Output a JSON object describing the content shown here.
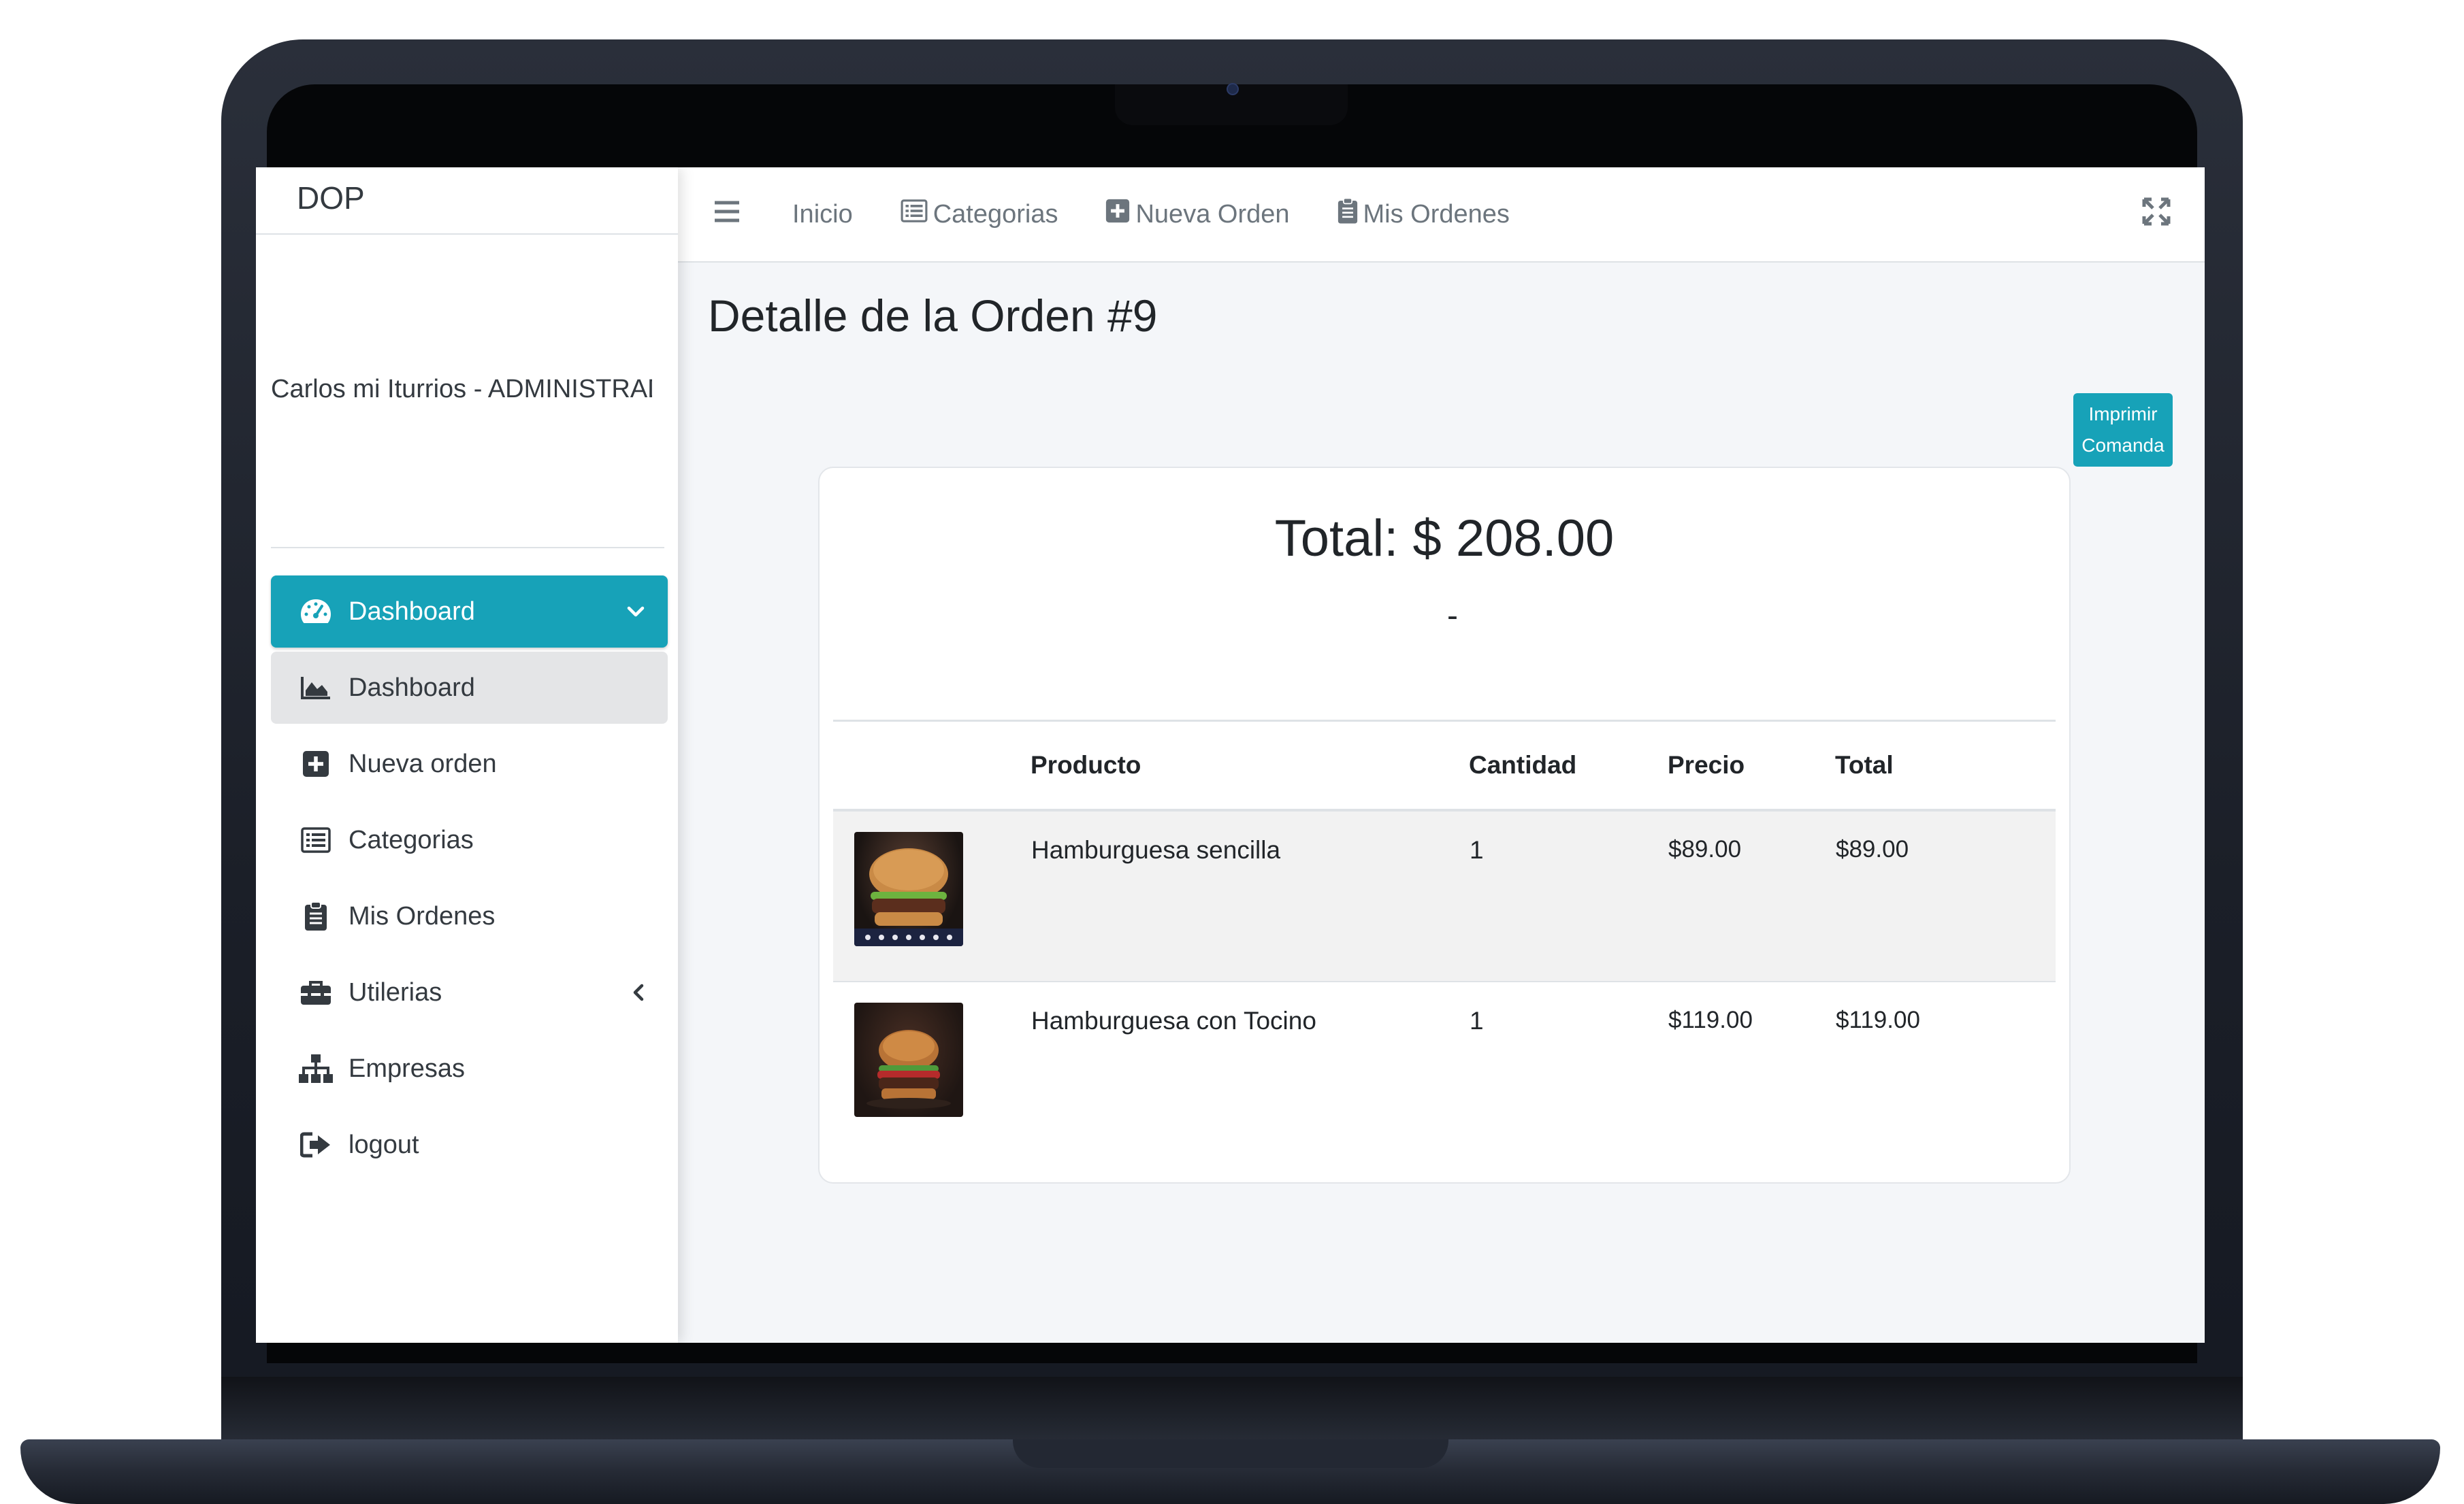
{
  "brand": "DOP",
  "user": {
    "name": "Carlos mi Iturrios - ADMINISTRADOR"
  },
  "sidebar": {
    "items": [
      {
        "label": "Dashboard",
        "icon": "tachometer-icon",
        "active": true
      },
      {
        "label": "Dashboard",
        "icon": "area-chart-icon"
      },
      {
        "label": "Nueva orden",
        "icon": "plus-square-icon"
      },
      {
        "label": "Categorias",
        "icon": "list-alt-icon"
      },
      {
        "label": "Mis Ordenes",
        "icon": "clipboard-icon"
      },
      {
        "label": "Utilerias",
        "icon": "toolbox-icon"
      },
      {
        "label": "Empresas",
        "icon": "sitemap-icon"
      },
      {
        "label": "logout",
        "icon": "sign-out-icon"
      }
    ]
  },
  "topbar": {
    "nav": [
      {
        "label": "Inicio"
      },
      {
        "label": "Categorias",
        "icon": "list-alt-icon"
      },
      {
        "label": "Nueva Orden",
        "icon": "plus-square-icon"
      },
      {
        "label": "Mis Ordenes",
        "icon": "clipboard-icon"
      }
    ]
  },
  "page": {
    "title": "Detalle de la Orden #9",
    "print_button": {
      "line1": "Imprimir",
      "line2": "Comanda"
    },
    "total": "Total: $ 208.00",
    "subtitle": "-"
  },
  "table": {
    "columns": [
      "",
      "Producto",
      "Cantidad",
      "Precio",
      "Total"
    ],
    "rows": [
      {
        "producto": "Hamburguesa sencilla",
        "cantidad": "1",
        "precio": "$89.00",
        "total": "$89.00"
      },
      {
        "producto": "Hamburguesa con Tocino",
        "cantidad": "1",
        "precio": "$119.00",
        "total": "$119.00"
      }
    ]
  },
  "colors": {
    "accent": "#17a2b8",
    "sidebar_active_sub": "#e4e5e7",
    "background": "#f4f6f9"
  }
}
